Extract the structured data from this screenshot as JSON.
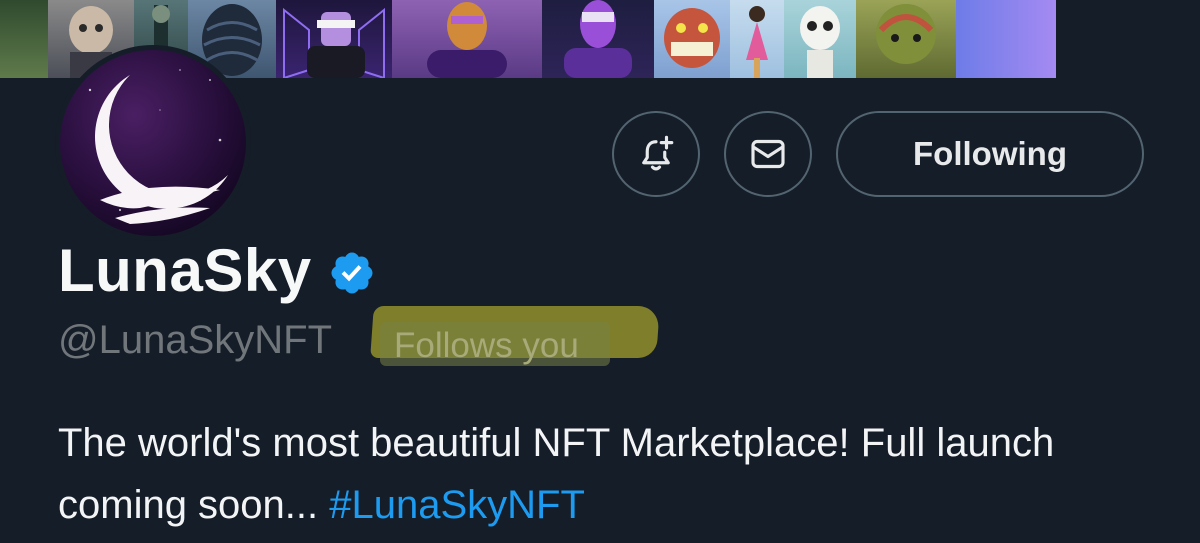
{
  "banner": {
    "tiles": [
      {
        "name": "banner-art-forest",
        "bg": "#3b5a3a"
      },
      {
        "name": "banner-art-cat",
        "bg": "#6b6f7a"
      },
      {
        "name": "banner-art-figure",
        "bg": "#40595a"
      },
      {
        "name": "banner-art-armadillo",
        "bg": "#5a6f86"
      },
      {
        "name": "banner-art-neon-room",
        "bg": "#2a1f4a"
      },
      {
        "name": "banner-art-sunglasses-figure",
        "bg": "#3c2a55"
      },
      {
        "name": "banner-art-gold-figure",
        "bg": "#7a4f9a"
      },
      {
        "name": "banner-art-purple-figure",
        "bg": "#2a2050"
      },
      {
        "name": "banner-art-oni-mask",
        "bg": "#8fb0d8"
      },
      {
        "name": "banner-art-dancer",
        "bg": "#b4cbe0"
      },
      {
        "name": "banner-art-skeleton",
        "bg": "#9cc6cf"
      },
      {
        "name": "banner-art-lizard",
        "bg": "#7c8a45"
      },
      {
        "name": "banner-art-gradient",
        "bg": "#8a7be0"
      }
    ]
  },
  "profile": {
    "display_name": "LunaSky",
    "handle": "@LunaSkyNFT",
    "follows_you": "Follows you",
    "verified": true,
    "bio_text": "The world's most beautiful NFT Marketplace! Full launch coming soon... ",
    "bio_hashtag": "#LunaSkyNFT"
  },
  "actions": {
    "notify_icon": "bell-plus-icon",
    "message_icon": "envelope-icon",
    "following_label": "Following"
  },
  "colors": {
    "background": "#151d28",
    "accent": "#1d9bf0",
    "verified": "#1d9bf0",
    "highlight": "#85842a"
  }
}
